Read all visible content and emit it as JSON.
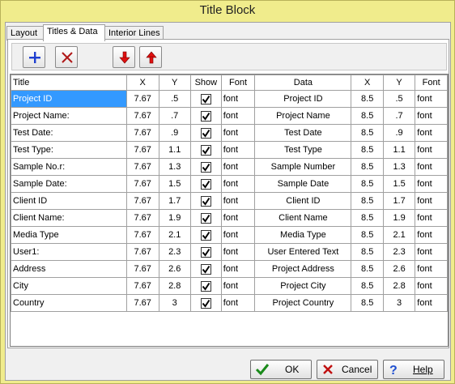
{
  "window": {
    "title": "Title Block"
  },
  "tabs": [
    {
      "label": "Layout",
      "active": false
    },
    {
      "label": "Titles & Data",
      "active": true
    },
    {
      "label": "Interior Lines",
      "active": false
    }
  ],
  "toolbar": {
    "add_icon": "plus-icon",
    "delete_icon": "x-icon",
    "down_icon": "arrow-down-icon",
    "up_icon": "arrow-up-icon"
  },
  "grid": {
    "columns": [
      "Title",
      "X",
      "Y",
      "Show",
      "Font",
      "Data",
      "X",
      "Y",
      "Font"
    ],
    "rows": [
      {
        "title": "Project ID",
        "x": "7.67",
        "y": ".5",
        "show": true,
        "font": "font",
        "data": "Project ID",
        "dx": "8.5",
        "dy": ".5",
        "dfont": "font"
      },
      {
        "title": "Project Name:",
        "x": "7.67",
        "y": ".7",
        "show": true,
        "font": "font",
        "data": "Project Name",
        "dx": "8.5",
        "dy": ".7",
        "dfont": "font"
      },
      {
        "title": "Test Date:",
        "x": "7.67",
        "y": ".9",
        "show": true,
        "font": "font",
        "data": "Test Date",
        "dx": "8.5",
        "dy": ".9",
        "dfont": "font"
      },
      {
        "title": "Test Type:",
        "x": "7.67",
        "y": "1.1",
        "show": true,
        "font": "font",
        "data": "Test Type",
        "dx": "8.5",
        "dy": "1.1",
        "dfont": "font"
      },
      {
        "title": "Sample No.r:",
        "x": "7.67",
        "y": "1.3",
        "show": true,
        "font": "font",
        "data": "Sample Number",
        "dx": "8.5",
        "dy": "1.3",
        "dfont": "font"
      },
      {
        "title": "Sample Date:",
        "x": "7.67",
        "y": "1.5",
        "show": true,
        "font": "font",
        "data": "Sample Date",
        "dx": "8.5",
        "dy": "1.5",
        "dfont": "font"
      },
      {
        "title": "Client ID",
        "x": "7.67",
        "y": "1.7",
        "show": true,
        "font": "font",
        "data": "Client ID",
        "dx": "8.5",
        "dy": "1.7",
        "dfont": "font"
      },
      {
        "title": "Client Name:",
        "x": "7.67",
        "y": "1.9",
        "show": true,
        "font": "font",
        "data": "Client Name",
        "dx": "8.5",
        "dy": "1.9",
        "dfont": "font"
      },
      {
        "title": "Media Type",
        "x": "7.67",
        "y": "2.1",
        "show": true,
        "font": "font",
        "data": "Media Type",
        "dx": "8.5",
        "dy": "2.1",
        "dfont": "font"
      },
      {
        "title": "User1:",
        "x": "7.67",
        "y": "2.3",
        "show": true,
        "font": "font",
        "data": "User Entered Text",
        "dx": "8.5",
        "dy": "2.3",
        "dfont": "font"
      },
      {
        "title": "Address",
        "x": "7.67",
        "y": "2.6",
        "show": true,
        "font": "font",
        "data": "Project Address",
        "dx": "8.5",
        "dy": "2.6",
        "dfont": "font"
      },
      {
        "title": "City",
        "x": "7.67",
        "y": "2.8",
        "show": true,
        "font": "font",
        "data": "Project City",
        "dx": "8.5",
        "dy": "2.8",
        "dfont": "font"
      },
      {
        "title": "Country",
        "x": "7.67",
        "y": "3",
        "show": true,
        "font": "font",
        "data": "Project Country",
        "dx": "8.5",
        "dy": "3",
        "dfont": "font"
      }
    ]
  },
  "buttons": {
    "ok_label": "OK",
    "cancel_label": "Cancel",
    "help_label": "Help"
  },
  "colors": {
    "title_bar": "#f0ec8c",
    "selection": "#3399ff",
    "add_icon": "#1f3fd0",
    "arrow_icon": "#e01010"
  }
}
